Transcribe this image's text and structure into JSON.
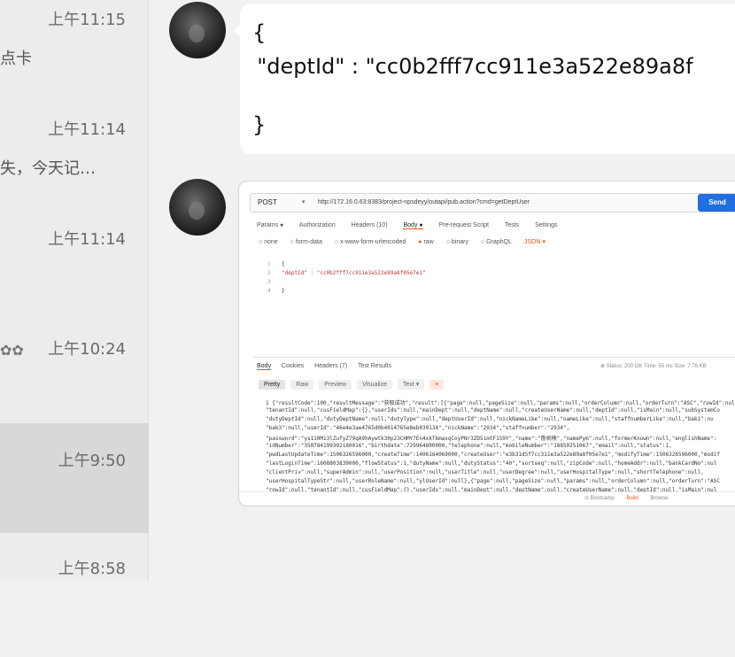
{
  "conversations": [
    {
      "time": "上午11:15",
      "snippet": "点卡"
    },
    {
      "time": "上午11:14",
      "snippet": "失，今天记…"
    },
    {
      "time": "上午11:14",
      "snippet": ""
    },
    {
      "time": "上午10:24",
      "snippet": ""
    },
    {
      "time": "上午9:50",
      "snippet": ""
    },
    {
      "time": "上午8:58",
      "snippet": ""
    }
  ],
  "messages": {
    "code_bubble": {
      "line1": "{",
      "line2": "  \"deptId\" : \"cc0b2fff7cc911e3a522e89a8f",
      "line3": "}"
    }
  },
  "postman": {
    "method": "POST",
    "url": "http://172.16.0.63:8383/project-npsdeyy/outapi/pub.action?cmd=getDeptUser",
    "send_label": "Send",
    "request_tabs": [
      "Params ●",
      "Authorization",
      "Headers (10)",
      "Body ●",
      "Pre-request Script",
      "Tests",
      "Settings"
    ],
    "body_types": [
      "none",
      "form-data",
      "x-www-form-urlencoded",
      "raw",
      "binary",
      "GraphQL",
      "JSON ▾"
    ],
    "editor_lines": [
      {
        "n": "1",
        "t": "{"
      },
      {
        "n": "2",
        "t": "  \"deptId\" : \"cc0b2fff7cc911e3a522e89a8f05e7e1\""
      },
      {
        "n": "3",
        "t": ""
      },
      {
        "n": "4",
        "t": "}"
      }
    ],
    "response_tabs": [
      "Body",
      "Cookies",
      "Headers (7)",
      "Test Results"
    ],
    "status_text": "Status: 200 OK   Time: 55 ms   Size: 7.76 KB",
    "format_tabs": [
      "Pretty",
      "Raw",
      "Preview",
      "Visualize",
      "Text ▾"
    ],
    "response_lines": [
      "1  {\"resultCode\":100,\"resultMessage\":\"获取成功\",\"result\":[{\"page\":null,\"pageSize\":null,\"params\":null,\"orderColumn\":null,\"orderTurn\":\"ASC\",\"rowId\":nul",
      "   \"tenantId\":null,\"cusFieldMap\":{},\"userIds\":null,\"mainDept\":null,\"deptName\":null,\"createUserName\":null,\"deptId\":null,\"isMain\":null,\"subSystemCo",
      "   \"dutyDeptId\":null,\"dutyDeptName\":null,\"dutyType\":null,\"deptUserId\":null,\"nickNameLike\":null,\"nameLike\":null,\"staffnumberLike\":null,\"bak1\":nu",
      "   \"bak3\":null,\"userId\":\"46e4e3ae4765d0b4014765e8eb030134\",\"nickName\":\"2934\",\"staffnumber\":\"2934\",",
      "   \"password\":\"ys110M13lZufyZ79qA9hAywtk30p23CHMY7En4xkTkmaxqCoyPNr3ZD5imtF159Y\",\"name\":\"詹祝楠\",\"namePym\":null,\"formerKnown\":null,\"englishName\":",
      "   \"idNumber\":\"350784199302180016\",\"birthdate\":729964800000,\"telephone\":null,\"mobileNumber\":\"18850251067\",\"email\":null,\"status\":1,",
      "   \"pwdLastUpdateTime\":1506326596000,\"createTime\":1406164069000,\"createUser\":\"e3b31d5f7cc311e3a522e89a8f05e7e1\",\"modifyTime\":1506326596000,\"modif",
      "   \"lastLoginTime\":1608803839000,\"flowStatus\":1,\"dutyName\":null,\"dutyStatus\":\"40\",\"sortseq\":null,\"zipCode\":null,\"homeAddr\":null,\"bankCardNo\":nul",
      "   \"clientPriv\":null,\"superAdmin\":null,\"userPosition\":null,\"userTitle\":null,\"userDegree\":null,\"userHospitalType\":null,\"shortTelephone\":null,",
      "   \"userHospitalTypeStr\":null,\"userRoleName\":null,\"ylUserId\":null},{\"page\":null,\"pageSize\":null,\"params\":null,\"orderColumn\":null,\"orderTurn\":\"ASC",
      "   \"rowId\":null,\"tenantId\":null,\"cusFieldMap\":{},\"userIds\":null,\"mainDept\":null,\"deptName\":null,\"createUserName\":null,\"deptId\":null,\"isMain\":nul"
    ],
    "bottom_bar": [
      "Bootcamp",
      "Build",
      "Browse"
    ]
  },
  "colors": {
    "send": "#1f6fe0",
    "accent": "#e8590c",
    "selected": "#d8d8da"
  }
}
